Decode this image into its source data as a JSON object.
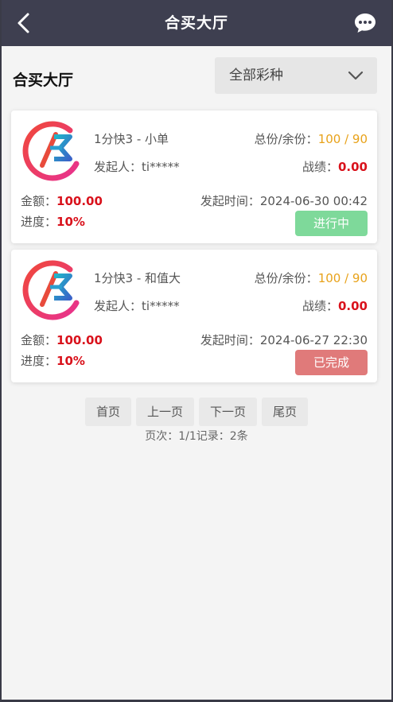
{
  "header": {
    "title": "合买大厅"
  },
  "section": {
    "title": "合买大厅",
    "lottery_filter": "全部彩种"
  },
  "orders": [
    {
      "name": "1分快3 - 小单",
      "shares_label": "总份/余份：",
      "shares_value": "100 / 90",
      "initiator_label": "发起人：",
      "initiator": "ti*****",
      "record_label": "战绩：",
      "record": "0.00",
      "amount_label": "金额：",
      "amount": "100.00",
      "time_label": "发起时间：",
      "time": "2024-06-30 00:42",
      "progress_label": "进度：",
      "progress": "10%",
      "status": "进行中",
      "status_color": "#7ed99a"
    },
    {
      "name": "1分快3 - 和值大",
      "shares_label": "总份/余份：",
      "shares_value": "100 / 90",
      "initiator_label": "发起人：",
      "initiator": "ti*****",
      "record_label": "战绩：",
      "record": "0.00",
      "amount_label": "金额：",
      "amount": "100.00",
      "time_label": "发起时间：",
      "time": "2024-06-27 22:30",
      "progress_label": "进度：",
      "progress": "10%",
      "status": "已完成",
      "status_color": "#e07a7a"
    }
  ],
  "pager": {
    "first": "首页",
    "prev": "上一页",
    "next": "下一页",
    "last": "尾页",
    "info": "页次：1/1记录：2条"
  },
  "colors": {
    "header_bg": "#3e3f50",
    "accent_red": "#d9121c",
    "shares_orange": "#e8a21a"
  },
  "icons": {
    "back": "chevron-left-icon",
    "chat": "chat-bubble-icon",
    "dropdown": "chevron-down-icon",
    "logo": "lottery-logo-icon"
  }
}
